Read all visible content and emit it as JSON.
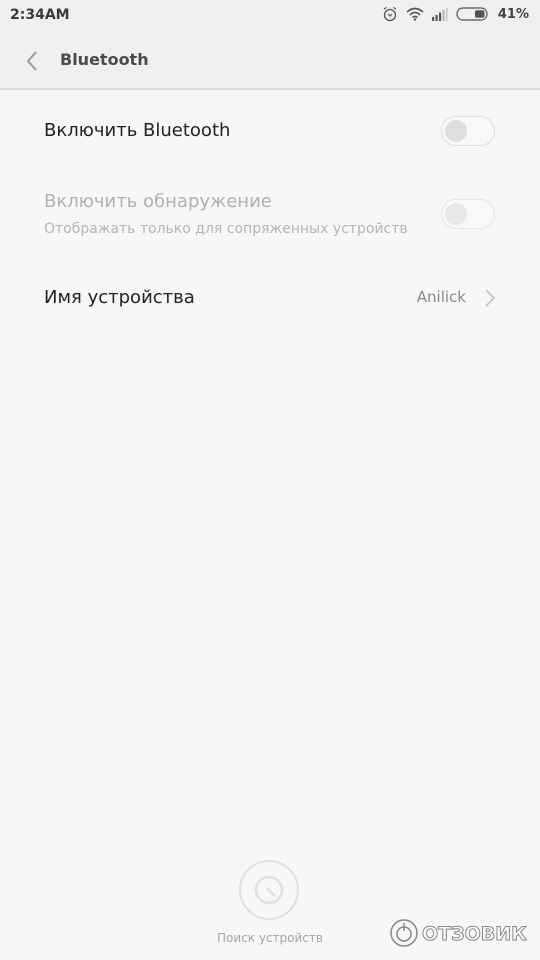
{
  "status_bar": {
    "time": "2:34AM",
    "battery_percent": "41%",
    "icons": [
      "alarm-icon",
      "wifi-icon",
      "signal-icon",
      "battery-icon"
    ]
  },
  "header": {
    "back_icon": "chevron-left-icon",
    "title": "Bluetooth"
  },
  "settings": {
    "enable_bluetooth": {
      "title": "Включить Bluetooth",
      "toggle_state": "off"
    },
    "discoverable": {
      "title": "Включить обнаружение",
      "subtitle": "Отображать только для сопряженных устройств",
      "toggle_state": "off",
      "enabled": false
    },
    "device_name": {
      "title": "Имя устройства",
      "value": "Anilick",
      "icon": "chevron-right-icon"
    }
  },
  "bottom": {
    "search_label": "Поиск устройств",
    "search_icon": "refresh-scan-icon"
  },
  "watermark": {
    "text": "ОТЗОВИК"
  }
}
